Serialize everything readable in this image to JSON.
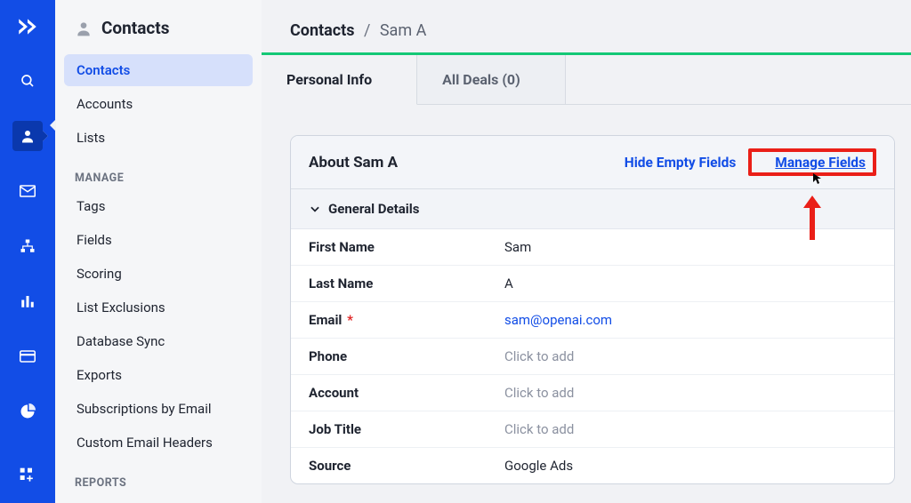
{
  "rail": {
    "items": [
      "search",
      "contacts",
      "mail",
      "sitemap",
      "bars",
      "card",
      "pie",
      "add"
    ]
  },
  "sidebar": {
    "title": "Contacts",
    "primary": [
      {
        "label": "Contacts",
        "active": true
      },
      {
        "label": "Accounts",
        "active": false
      },
      {
        "label": "Lists",
        "active": false
      }
    ],
    "groups": [
      {
        "label": "MANAGE",
        "items": [
          "Tags",
          "Fields",
          "Scoring",
          "List Exclusions",
          "Database Sync",
          "Exports",
          "Subscriptions by Email",
          "Custom Email Headers"
        ]
      },
      {
        "label": "REPORTS",
        "items": []
      }
    ]
  },
  "breadcrumb": {
    "root": "Contacts",
    "leaf": "Sam A"
  },
  "tabs": [
    {
      "label": "Personal Info",
      "active": true
    },
    {
      "label": "All Deals (0)",
      "active": false
    }
  ],
  "panel": {
    "title": "About Sam A",
    "hide_empty": "Hide Empty Fields",
    "manage": "Manage Fields",
    "section": "General Details",
    "fields": [
      {
        "label": "First Name",
        "value": "Sam",
        "type": "text"
      },
      {
        "label": "Last Name",
        "value": "A",
        "type": "text"
      },
      {
        "label": "Email",
        "required": true,
        "value": "sam@openai.com",
        "type": "link"
      },
      {
        "label": "Phone",
        "value": "Click to add",
        "type": "placeholder"
      },
      {
        "label": "Account",
        "value": "Click to add",
        "type": "placeholder"
      },
      {
        "label": "Job Title",
        "value": "Click to add",
        "type": "placeholder"
      },
      {
        "label": "Source",
        "value": "Google Ads",
        "type": "text"
      }
    ]
  }
}
